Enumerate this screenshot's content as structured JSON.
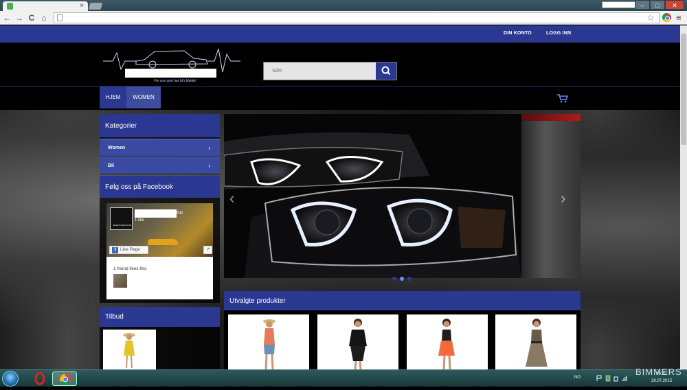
{
  "browser": {
    "tab_close": "×",
    "nav_back": "←",
    "nav_forward": "→",
    "nav_reload": "C",
    "nav_home": "⌂",
    "star": "☆",
    "menu": "≡",
    "win_min": "–",
    "win_max": "□",
    "win_close": "✕"
  },
  "topbar": {
    "account": "DIN KONTO",
    "login": "LOGG INN",
    "color": "#2a3891"
  },
  "header": {
    "tagline": "For oss som har bil i blodet!",
    "search_placeholder": "SØK"
  },
  "nav": {
    "home": "HJEM",
    "women": "WOMEN"
  },
  "sidebar": {
    "categories_title": "Kategorier",
    "categories": [
      {
        "label": "Women",
        "chevron": "›"
      },
      {
        "label": "Bil",
        "chevron": "›"
      }
    ],
    "facebook_title": "Følg oss på Facebook",
    "facebook": {
      "page_name_suffix": "no",
      "likes": "1 like",
      "like_button": "Like Page",
      "share": "↗",
      "friends_text": "1 friend likes this",
      "avatar_text": "BILENTUSIAST.NO",
      "f_letter": "f"
    },
    "offers_title": "Tilbud"
  },
  "slider": {
    "prev": "‹",
    "next": "›",
    "dots": 3,
    "active_dot": 1
  },
  "products": {
    "title": "Utvalgte produkter",
    "items": [
      {
        "name": "product-1",
        "top": "#e67a5a",
        "bottom": "#6b8fb5"
      },
      {
        "name": "product-2",
        "top": "#151515",
        "bottom": "#1c1c1c"
      },
      {
        "name": "product-3",
        "top": "#1e1e1e",
        "bottom": "#f26a3c"
      },
      {
        "name": "product-4",
        "top": "#6a5a48",
        "bottom": "#8a7a64"
      }
    ]
  },
  "taskbar": {
    "lang": "NO",
    "time": "10:22",
    "date": "28.07.2015",
    "watermark": "BIMMERS"
  }
}
